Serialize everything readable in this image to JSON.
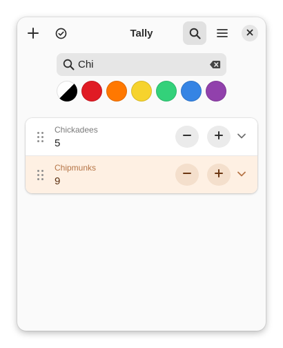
{
  "app": {
    "title": "Tally"
  },
  "header": {
    "add_icon": "plus-icon",
    "select_icon": "check-circle-icon",
    "search_icon": "search-icon",
    "menu_icon": "hamburger-menu-icon",
    "close_icon": "close-icon"
  },
  "search": {
    "value": "Chi",
    "placeholder": ""
  },
  "color_filters": {
    "options": [
      {
        "name": "all",
        "color": "#000000"
      },
      {
        "name": "red",
        "color": "#e01b24"
      },
      {
        "name": "orange",
        "color": "#ff7800"
      },
      {
        "name": "yellow",
        "color": "#f6d32d"
      },
      {
        "name": "green",
        "color": "#33d17a"
      },
      {
        "name": "blue",
        "color": "#3584e4"
      },
      {
        "name": "purple",
        "color": "#9141ac"
      }
    ]
  },
  "counters": [
    {
      "name": "Chickadees",
      "count": "5",
      "tint": "#ffffff",
      "name_color": "#7a7a7a",
      "count_color": "#1e1e1e",
      "button_bg": "#ebebeb",
      "icon_color": "#2e2e2e",
      "chevron_color": "#6e6e6e"
    },
    {
      "name": "Chipmunks",
      "count": "9",
      "tint": "#fef0e3",
      "name_color": "#b57446",
      "count_color": "#5a2e0e",
      "button_bg": "#f4dfcc",
      "icon_color": "#6b3510",
      "chevron_color": "#b57446"
    }
  ]
}
